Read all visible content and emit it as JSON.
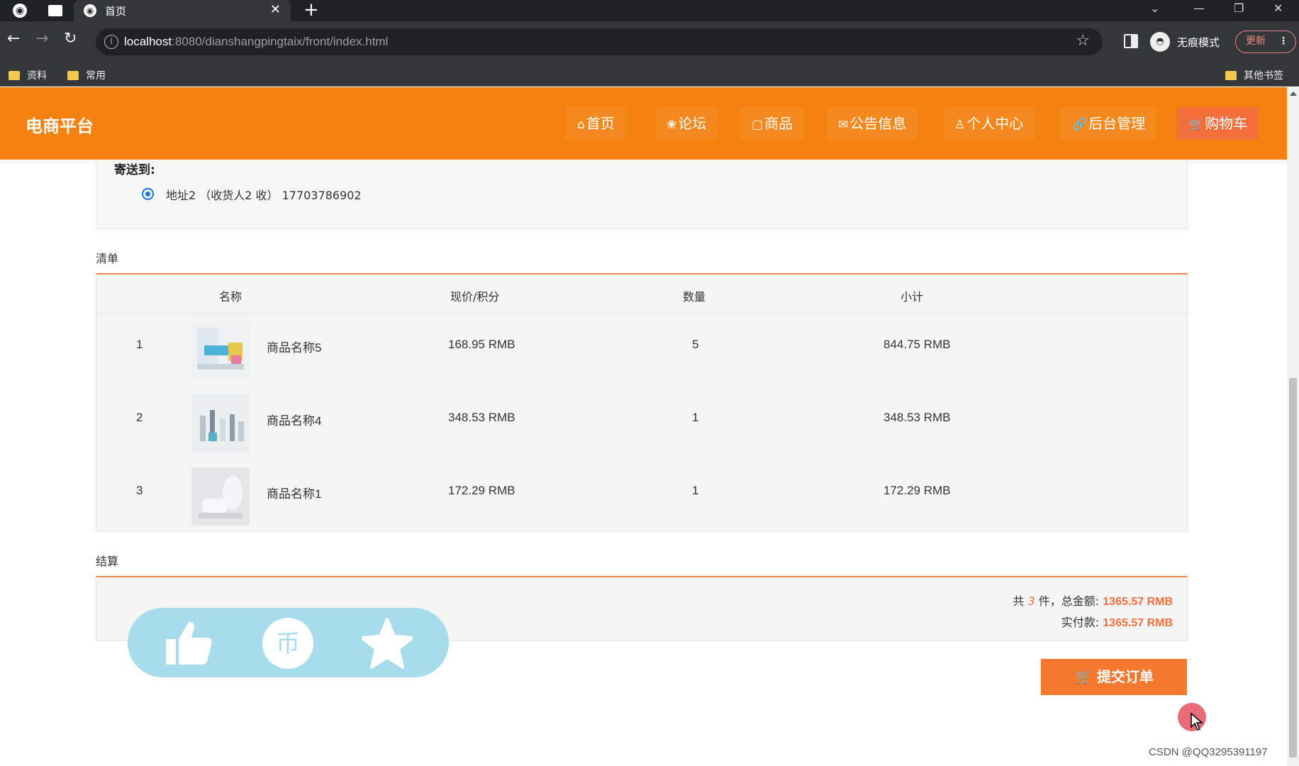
{
  "browser": {
    "tab_title": "首页",
    "url_host": "localhost",
    "url_path": ":8080/dianshangpingtaix/front/index.html",
    "incognito_label": "无痕模式",
    "update_label": "更新",
    "bookmarks": [
      "资料",
      "常用"
    ],
    "other_bookmarks": "其他书签"
  },
  "header": {
    "logo": "电商平台",
    "nav": [
      {
        "icon": "⌂",
        "label": "首页"
      },
      {
        "icon": "❀",
        "label": "论坛"
      },
      {
        "icon": "▢",
        "label": "商品"
      },
      {
        "icon": "✉",
        "label": "公告信息"
      },
      {
        "icon": "♙",
        "label": "个人中心"
      },
      {
        "icon": "🔗",
        "label": "后台管理"
      },
      {
        "icon": "🛒",
        "label": "购物车"
      }
    ]
  },
  "shipping": {
    "label": "寄送到:",
    "address": "地址2 （收货人2 收） 17703786902"
  },
  "list": {
    "section_label": "清单",
    "headers": {
      "name": "名称",
      "price": "现价/积分",
      "qty": "数量",
      "subtotal": "小计"
    },
    "rows": [
      {
        "index": "1",
        "name": "商品名称5",
        "price": "168.95 RMB",
        "qty": "5",
        "subtotal": "844.75 RMB"
      },
      {
        "index": "2",
        "name": "商品名称4",
        "price": "348.53 RMB",
        "qty": "1",
        "subtotal": "348.53 RMB"
      },
      {
        "index": "3",
        "name": "商品名称1",
        "price": "172.29 RMB",
        "qty": "1",
        "subtotal": "172.29 RMB"
      }
    ]
  },
  "settlement": {
    "section_label": "结算",
    "count_prefix": "共",
    "count": "3",
    "count_suffix": "件，总金额:",
    "total": "1365.57 RMB",
    "paid_label": "实付款:",
    "paid": "1365.57 RMB"
  },
  "submit_label": "提交订单",
  "watermark": "CSDN @QQ3295391197",
  "colors": {
    "brand": "#f5820f",
    "accent": "#f46f3b",
    "pill": "#a6dcec"
  }
}
